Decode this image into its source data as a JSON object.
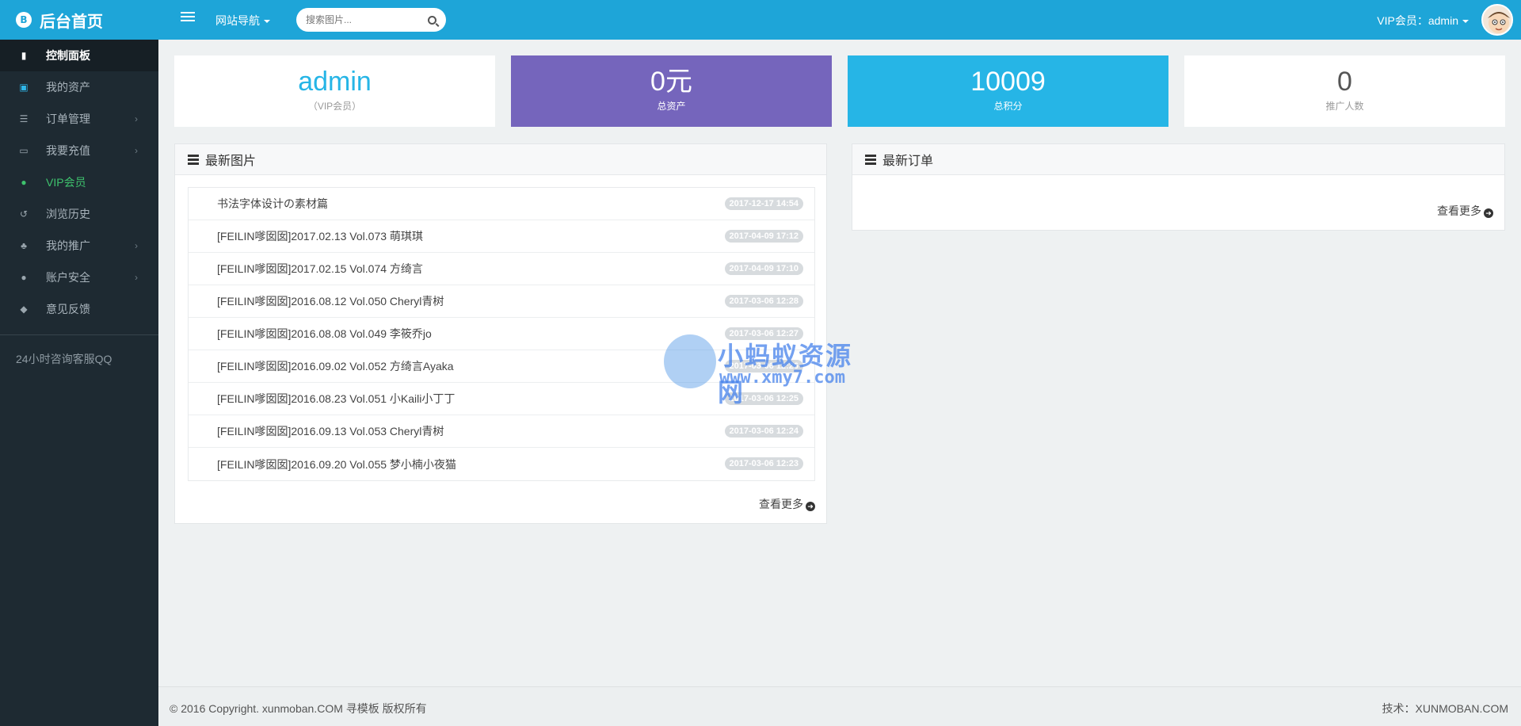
{
  "brand": {
    "title": "后台首页",
    "coin": "B"
  },
  "sidebar": {
    "items": [
      {
        "label": "控制面板",
        "icon": "bar-chart-icon",
        "glyph": "▮"
      },
      {
        "label": "我的资产",
        "icon": "money-icon",
        "glyph": "▣"
      },
      {
        "label": "订单管理",
        "icon": "list-icon",
        "glyph": "☰"
      },
      {
        "label": "我要充值",
        "icon": "credit-card-icon",
        "glyph": "▭"
      },
      {
        "label": "VIP会员",
        "icon": "user-icon",
        "glyph": "●"
      },
      {
        "label": "浏览历史",
        "icon": "history-icon",
        "glyph": "↺"
      },
      {
        "label": "我的推广",
        "icon": "users-icon",
        "glyph": "♣"
      },
      {
        "label": "账户安全",
        "icon": "user-icon",
        "glyph": "●"
      },
      {
        "label": "意见反馈",
        "icon": "comment-icon",
        "glyph": "◆"
      }
    ],
    "qq_label": "24小时咨询客服QQ"
  },
  "topbar": {
    "site_nav": "网站导航",
    "search_placeholder": "搜索图片...",
    "user_label": "VIP会员：admin"
  },
  "stats": [
    {
      "value": "admin",
      "label": "（VIP会员）"
    },
    {
      "value": "0元",
      "label": "总资产"
    },
    {
      "value": "10009",
      "label": "总积分"
    },
    {
      "value": "0",
      "label": "推广人数"
    }
  ],
  "latest_images": {
    "title": "最新图片",
    "more": "查看更多",
    "rows": [
      {
        "title": "书法字体设计の素材篇",
        "time": "2017-12-17 14:54"
      },
      {
        "title": "[FEILIN嗲囡囡]2017.02.13 Vol.073 萌琪琪",
        "time": "2017-04-09 17:12"
      },
      {
        "title": "[FEILIN嗲囡囡]2017.02.15 Vol.074 方绮言",
        "time": "2017-04-09 17:10"
      },
      {
        "title": "[FEILIN嗲囡囡]2016.08.12 Vol.050 Cheryl青树",
        "time": "2017-03-06 12:28"
      },
      {
        "title": "[FEILIN嗲囡囡]2016.08.08 Vol.049 李筱乔jo",
        "time": "2017-03-06 12:27"
      },
      {
        "title": "[FEILIN嗲囡囡]2016.09.02 Vol.052 方绮言Ayaka",
        "time": "2017-03-06 12:26"
      },
      {
        "title": "[FEILIN嗲囡囡]2016.08.23 Vol.051 小Kaili小丁丁",
        "time": "2017-03-06 12:25"
      },
      {
        "title": "[FEILIN嗲囡囡]2016.09.13 Vol.053 Cheryl青树",
        "time": "2017-03-06 12:24"
      },
      {
        "title": "[FEILIN嗲囡囡]2016.09.20 Vol.055 梦小楠小夜猫",
        "time": "2017-03-06 12:23"
      }
    ]
  },
  "latest_orders": {
    "title": "最新订单",
    "more": "查看更多"
  },
  "watermark": {
    "line1": "小蚂蚁资源网",
    "line2": "www.xmy7.com"
  },
  "footer": {
    "copyright": "© 2016 Copyright. xunmoban.COM 寻模板 版权所有",
    "tech": "技术：XUNMOBAN.COM"
  },
  "colors": {
    "topbar": "#1ea5d8",
    "sidebar": "#1e2a32",
    "purple": "#7565bc",
    "cyan": "#26b5e6",
    "vip_green": "#3ec26d",
    "admin_text": "#26b5e6"
  }
}
